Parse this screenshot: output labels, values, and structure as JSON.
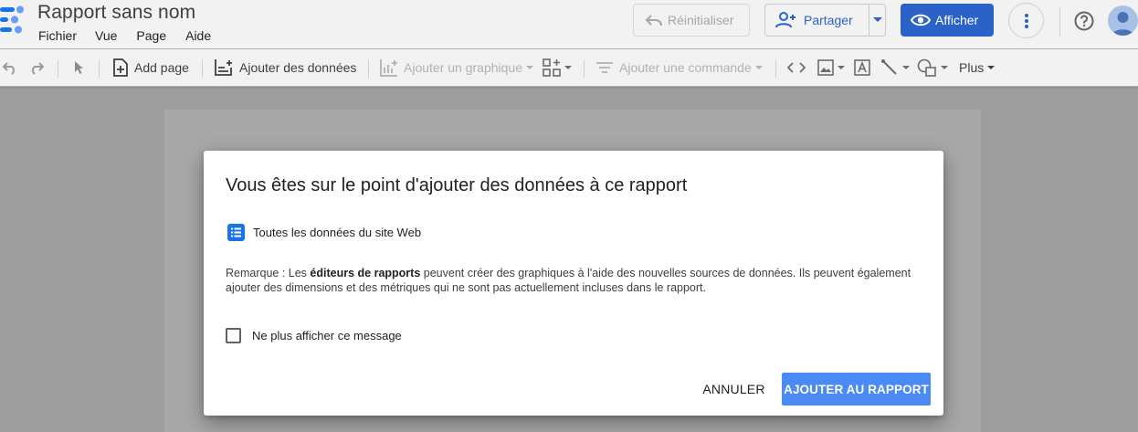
{
  "header": {
    "title": "Rapport sans nom",
    "menus": [
      "Fichier",
      "Vue",
      "Page",
      "Aide"
    ],
    "reset_label": "Réinitialiser",
    "share_label": "Partager",
    "view_label": "Afficher"
  },
  "toolbar": {
    "add_page": "Add page",
    "add_data": "Ajouter des données",
    "add_chart": "Ajouter un graphique",
    "add_control": "Ajouter une commande",
    "more": "Plus"
  },
  "dialog": {
    "title": "Vous êtes sur le point d'ajouter des données à ce rapport",
    "datasource": "Toutes les données du site Web",
    "note_prefix": "Remarque : Les ",
    "note_bold": "éditeurs de rapports",
    "note_rest": " peuvent créer des graphiques à l'aide des nouvelles sources de données. Ils peuvent également ajouter des dimensions et des métriques qui ne sont pas actuellement incluses dans le rapport.",
    "checkbox_label": "Ne plus afficher ce message",
    "checkbox_checked": false,
    "cancel_label": "ANNULER",
    "confirm_label": "AJOUTER AU RAPPORT"
  },
  "colors": {
    "accent": "#2b62c8",
    "confirm": "#4a8af4"
  }
}
